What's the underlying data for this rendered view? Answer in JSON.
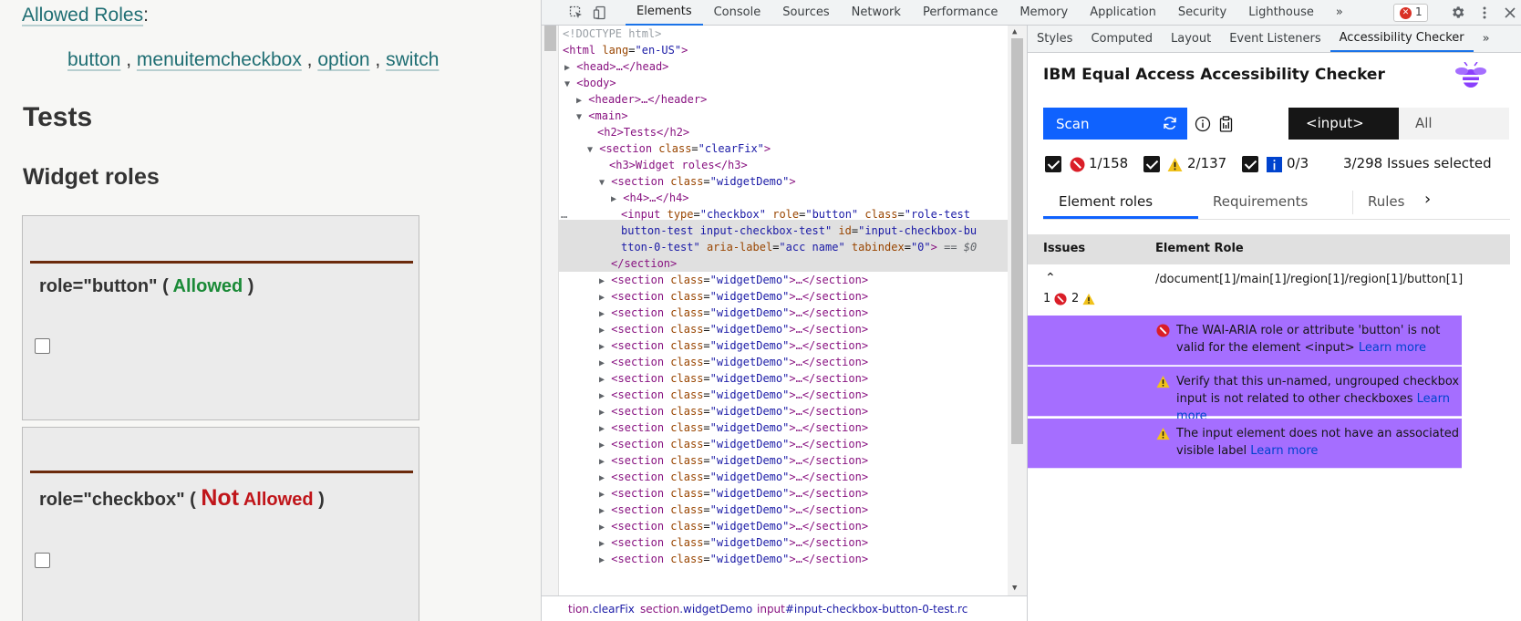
{
  "page": {
    "allowed_label": "Allowed Roles",
    "allowed_colon": ":",
    "roles": [
      "button",
      "menuitemcheckbox",
      "option",
      "switch"
    ],
    "role_sep": " , ",
    "heading_tests": "Tests",
    "heading_widget": "Widget roles",
    "demo1": {
      "prefix": "role=\"button\" ( ",
      "status": "Allowed",
      "suffix": " )"
    },
    "demo2": {
      "prefix": "role=\"checkbox\" ( ",
      "status_not": "Not",
      "status_allowed": "Allowed",
      "suffix": " )"
    }
  },
  "devtools": {
    "tabs": [
      "Elements",
      "Console",
      "Sources",
      "Network",
      "Performance",
      "Memory",
      "Application",
      "Security",
      "Lighthouse"
    ],
    "more_tabs": "»",
    "error_count": "1",
    "dom_lines": {
      "doctype": "<!DOCTYPE html>",
      "html_open": "<html",
      "html_attr": "lang",
      "html_val": "\"en-US\"",
      "head": "<head>…</head>",
      "body": "<body>",
      "header": "<header>…</header>",
      "main": "<main>",
      "h2": "<h2>Tests</h2>",
      "section_clear": "<section",
      "class_attr": "class",
      "clear_val": "\"clearFix\"",
      "h3": "<h3>Widget roles</h3>",
      "widget_val": "\"widgetDemo\"",
      "h4": "<h4>…</h4>",
      "input_line1_a": "<input",
      "input_type_attr": "type",
      "input_type_val": "\"checkbox\"",
      "input_role_attr": "role",
      "input_role_val": "\"button\"",
      "input_class_val1": "\"role-test",
      "input_line2": "button-test input-checkbox-test\"",
      "input_id_attr": "id",
      "input_id_val1": "\"input-checkbox-bu",
      "input_line3": "tton-0-test\"",
      "input_aria_attr": "aria-label",
      "input_aria_val": "\"acc name\"",
      "input_tab_attr": "tabindex",
      "input_tab_val": "\"0\"",
      "input_eq": "== $0",
      "section_close": "</section>",
      "collapsed_section_tail": "…</section>",
      "ellipsis": "…"
    },
    "breadcrumbs": {
      "c1_tag": "tion",
      "c1_cls": ".clearFix",
      "c2_tag": "section",
      "c2_cls": ".widgetDemo",
      "c3_tag": "input",
      "c3_id": "#input-checkbox-button-0-test",
      "c3_tail": ".rc"
    },
    "side_tabs": [
      "Styles",
      "Computed",
      "Layout",
      "Event Listeners",
      "Accessibility Checker"
    ],
    "side_more": "»"
  },
  "checker": {
    "title": "IBM Equal Access Accessibility Checker",
    "scan_label": "Scan",
    "scope_input": "<input>",
    "scope_all": "All",
    "filters": {
      "violations": "1/158",
      "needs_review": "2/137",
      "recommendations": "0/3",
      "selected": "3/298 Issues selected"
    },
    "view_tabs": [
      "Element roles",
      "Requirements",
      "Rules"
    ],
    "table_headers": {
      "issues": "Issues",
      "role": "Element Role"
    },
    "row": {
      "xpath": "/document[1]/main[1]/region[1]/region[1]/button[1]",
      "violations_count": "1",
      "review_count": "2"
    },
    "issues": [
      {
        "type": "violation",
        "text": "The WAI-ARIA role or attribute 'button' is not valid for the element <input>",
        "link": "Learn more"
      },
      {
        "type": "review",
        "text": "Verify that this un-named, ungrouped checkbox input is not related to other checkboxes",
        "link": "Learn more"
      },
      {
        "type": "review",
        "text": "The input element does not have an associated visible label",
        "link": "Learn more"
      }
    ]
  },
  "colors": {
    "accent": "#0f62fe",
    "issue_bg": "#a56eff",
    "allowed": "#1a8a37",
    "not_allowed": "#c0151a",
    "violation": "#da1e28",
    "warning": "#f1c21b"
  }
}
